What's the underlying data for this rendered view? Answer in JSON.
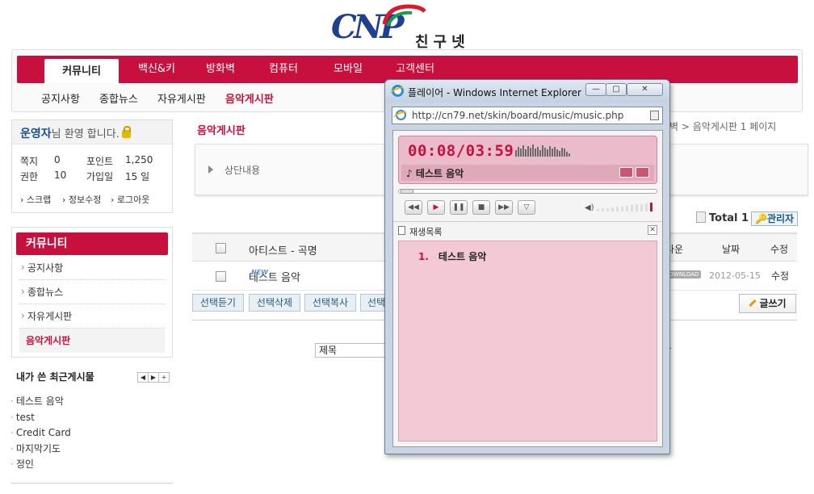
{
  "logo": {
    "brand": "CNP",
    "korean": "친구넷"
  },
  "nav": {
    "tabs": [
      "커뮤니티",
      "백신&키",
      "방화벽",
      "컴퓨터",
      "모바일",
      "고객센터"
    ],
    "subtabs": [
      "공지사항",
      "종합뉴스",
      "자유게시판",
      "음악게시판"
    ]
  },
  "user": {
    "name": "운영자",
    "greeting": "님 환영 합니다.",
    "note_label": "쪽지",
    "note_value": "0",
    "point_label": "포인트",
    "point_value": "1,250",
    "level_label": "권한",
    "level_value": "10",
    "joined_label": "가입일",
    "joined_value": "15 일",
    "links": [
      "스크랩",
      "정보수정",
      "로그아웃"
    ]
  },
  "community": {
    "title": "커뮤니티",
    "items": [
      "공지사항",
      "종합뉴스",
      "자유게시판",
      "음악게시판"
    ]
  },
  "recent": {
    "title": "내가 쓴 최근게시물",
    "controls": [
      "◀",
      "▶",
      "+"
    ],
    "items": [
      "테스트 음악",
      "test",
      "Credit Card",
      "마지막기도",
      "정인"
    ]
  },
  "board": {
    "title": "음악게시판",
    "breadcrumb": "화벽 > 음악게시판 1 페이지",
    "top_content": "상단내용",
    "total": "Total 1",
    "admin": "관리자",
    "columns": {
      "artist_title": "아티스트 - 곡명",
      "down": "다운",
      "date": "날짜",
      "edit": "수정"
    },
    "rows": [
      {
        "title": "테스트 음악",
        "new": "NEW",
        "down": "DOWNLOAD",
        "date": "2012-05-15",
        "edit": "수정"
      }
    ],
    "buttons": [
      "선택듣기",
      "선택삭제",
      "선택복사",
      "선택"
    ],
    "write": "글쓰기",
    "search_field": "제목",
    "search_suffix": "r"
  },
  "popup": {
    "title": "플레이어 - Windows Internet Explorer",
    "url": "http://cn79.net/skin/board/music/music.php",
    "time": "00:08/03:59",
    "track": "테스트 음악",
    "controls": [
      "◀◀",
      "▶",
      "❚❚",
      "■",
      "▶▶",
      "▽"
    ],
    "playlist_label": "재생목록",
    "playlist": [
      {
        "num": "1.",
        "title": "테스트 음악"
      }
    ],
    "win_buttons": [
      "—",
      "▢",
      "✕"
    ]
  }
}
